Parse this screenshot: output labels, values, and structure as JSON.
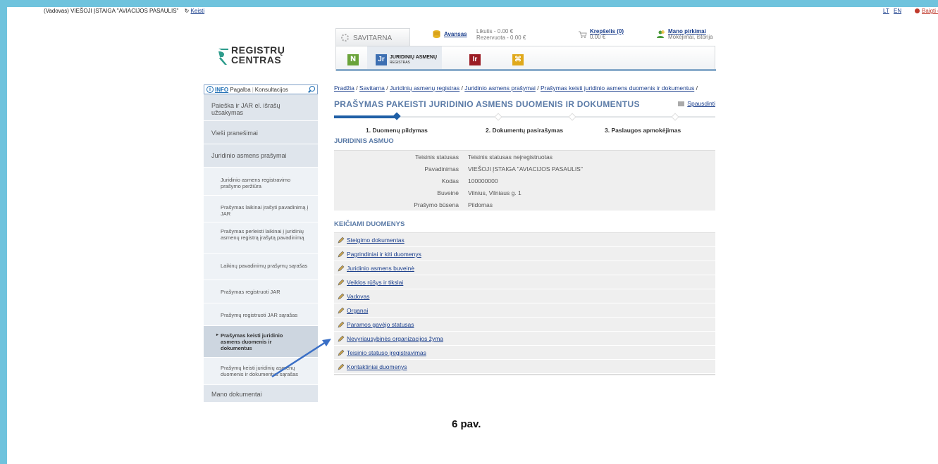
{
  "topbar": {
    "user_text": "(Vadovas)  VIEŠOJI ĮSTAIGA \"AVIACIJOS PASAULIS\"",
    "change_label": "Keisti",
    "lang_lt": "LT",
    "lang_en": "EN",
    "quit_label": "Baigti darbą"
  },
  "logo": {
    "line1": "REGISTRŲ",
    "line2": "CENTRAS"
  },
  "header": {
    "savitarna_label": "SAVITARNA",
    "avansas_label": "Avansas",
    "likutis": "Likutis - 0.00 €",
    "rezervuota": "Rezervuota - 0.00 €",
    "krepselis_label": "Krepšelis (0)",
    "krepselis_sum": "0.00 €",
    "pirkimai_label": "Mano pirkimai",
    "pirkimai_sub": "Mokėjimai, istorija",
    "jar_tab_line1": "JURIDINIŲ ASMENŲ",
    "jar_tab_line2": "REGISTRAS"
  },
  "infobox": {
    "info": "INFO",
    "pagalba": "Pagalba",
    "konsultacijos": "Konsultacijos"
  },
  "sidebar": {
    "items": [
      {
        "label": "Paieška ir JAR el. išrašų užsakymas"
      },
      {
        "label": "Vieši pranešimai"
      },
      {
        "label": "Juridinio asmens prašymai"
      },
      {
        "label": "Juridinio asmens registravimo prašymo peržiūra"
      },
      {
        "label": "Prašymas laikinai įrašyti pavadinimą į JAR"
      },
      {
        "label": "Prašymas perleisti laikinai į juridinių asmenų registrą įrašytą pavadinimą"
      },
      {
        "label": "Laikinų pavadinimų prašymų sąrašas"
      },
      {
        "label": "Prašymas registruoti JAR"
      },
      {
        "label": "Prašymų registruoti JAR sąrašas"
      },
      {
        "label": "Prašymas keisti juridinio asmens duomenis ir dokumentus"
      },
      {
        "label": "Prašymų keisti juridinių asmenų duomenis ir dokumentus sąrašas"
      },
      {
        "label": "Mano dokumentai"
      }
    ]
  },
  "breadcrumb": {
    "items": [
      "Pradžia",
      "Savitarna",
      "Juridinių asmenų registras",
      "Juridinio asmens prašymai",
      "Prašymas keisti juridinio asmens duomenis ir dokumentus"
    ],
    "sep": " / "
  },
  "main": {
    "title": "PRAŠYMAS PAKEISTI JURIDINIO ASMENS DUOMENIS IR DOKUMENTUS",
    "print_label": "Spausdinti",
    "steps": [
      "1. Duomenų pildymas",
      "2. Dokumentų pasirašymas",
      "3. Paslaugos apmokėjimas"
    ],
    "section1": "JURIDINIS ASMUO",
    "info_rows": [
      {
        "k": "Teisinis statusas",
        "v": "Teisinis statusas neįregistruotas"
      },
      {
        "k": "Pavadinimas",
        "v": "VIEŠOJI ĮSTAIGA \"AVIACIJOS PASAULIS\""
      },
      {
        "k": "Kodas",
        "v": "100000000"
      },
      {
        "k": "Buveinė",
        "v": "Vilnius, Vilniaus g. 1"
      },
      {
        "k": "Prašymo būsena",
        "v": "Pildomas"
      }
    ],
    "section2": "KEIČIAMI DUOMENYS",
    "change_links": [
      "Steigimo dokumentas",
      "Pagrindiniai ir kiti duomenys",
      "Juridinio asmens buveinė",
      "Veiklos rūšys ir tikslai",
      "Vadovas",
      "Organai",
      "Paramos gavėjo statusas",
      "Nevyriausybinės organizacijos žyma",
      "Teisinio statuso įregistravimas",
      "Kontaktiniai duomenys"
    ]
  },
  "caption": "6 pav.",
  "colors": {
    "frame": "#6fc3dd",
    "title": "#5b7ba7",
    "link": "#1a3e8c",
    "active_step": "#1f5fa6",
    "arrow": "#3a6fc6"
  }
}
